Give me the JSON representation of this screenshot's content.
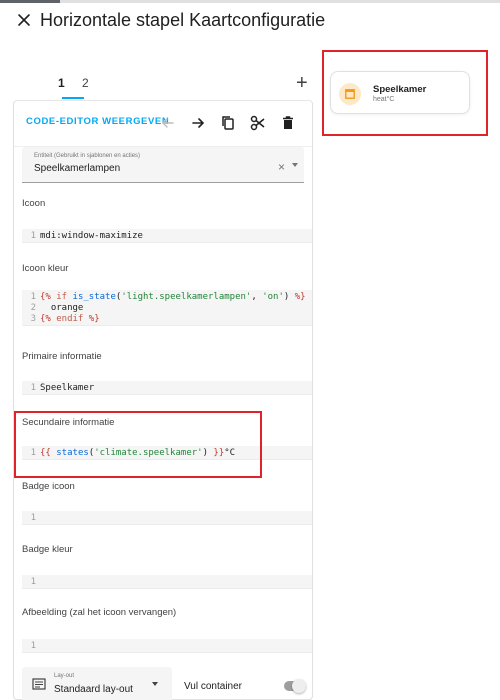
{
  "dialog": {
    "title": "Horizontale stapel Kaartconfiguratie"
  },
  "tabs": {
    "items": [
      "1",
      "2"
    ],
    "active_index": 0,
    "add_label": "+"
  },
  "toolbar": {
    "code_editor_label": "CODE-EDITOR WEERGEVEN",
    "tools": [
      "arrow-left-icon",
      "arrow-right-icon",
      "copy-icon",
      "cut-icon",
      "delete-icon"
    ]
  },
  "entity": {
    "label": "Entiteit (Gebruikt in sjablonen en acties)",
    "value": "Speelkamerlampen",
    "clear": "×"
  },
  "sections": {
    "icon": {
      "label": "Icoon",
      "lines": [
        [
          "1",
          "mdi:window-maximize"
        ]
      ]
    },
    "icon_color": {
      "label": "Icoon kleur",
      "line1": {
        "no": "1",
        "open": "{%",
        "kw_if": " if ",
        "fn": "is_state",
        "paren1": "(",
        "arg1": "'light.speelkamerlampen'",
        "comma": ", ",
        "arg2": "'on'",
        "paren2": ")",
        "close": " %}"
      },
      "line2": {
        "no": "2",
        "text": "  orange"
      },
      "line3": {
        "no": "3",
        "open": "{%",
        "kw": " endif ",
        "close": "%}"
      }
    },
    "primary": {
      "label": "Primaire informatie",
      "lines": [
        [
          "1",
          "Speelkamer"
        ]
      ]
    },
    "secondary": {
      "label": "Secundaire informatie",
      "line1": {
        "no": "1",
        "open": "{{ ",
        "fn": "states",
        "paren1": "(",
        "arg": "'climate.speelkamer'",
        "paren2": ")",
        "close": " }}",
        "suffix": "°C"
      }
    },
    "badge_icon": {
      "label": "Badge icoon",
      "lines": [
        [
          "1",
          ""
        ]
      ]
    },
    "badge_color": {
      "label": "Badge kleur",
      "lines": [
        [
          "1",
          ""
        ]
      ]
    },
    "image": {
      "label": "Afbeelding (zal het icoon vervangen)",
      "lines": [
        [
          "1",
          ""
        ]
      ]
    }
  },
  "layout": {
    "label": "Lay-out",
    "value": "Standaard lay-out",
    "fill_label": "Vul container"
  },
  "preview": {
    "primary": "Speelkamer",
    "secondary": "heat°C",
    "icon": "window-maximize-icon",
    "icon_color": "#f39c12"
  },
  "colors": {
    "accent": "#03a9f4",
    "highlight": "#e0232b"
  }
}
